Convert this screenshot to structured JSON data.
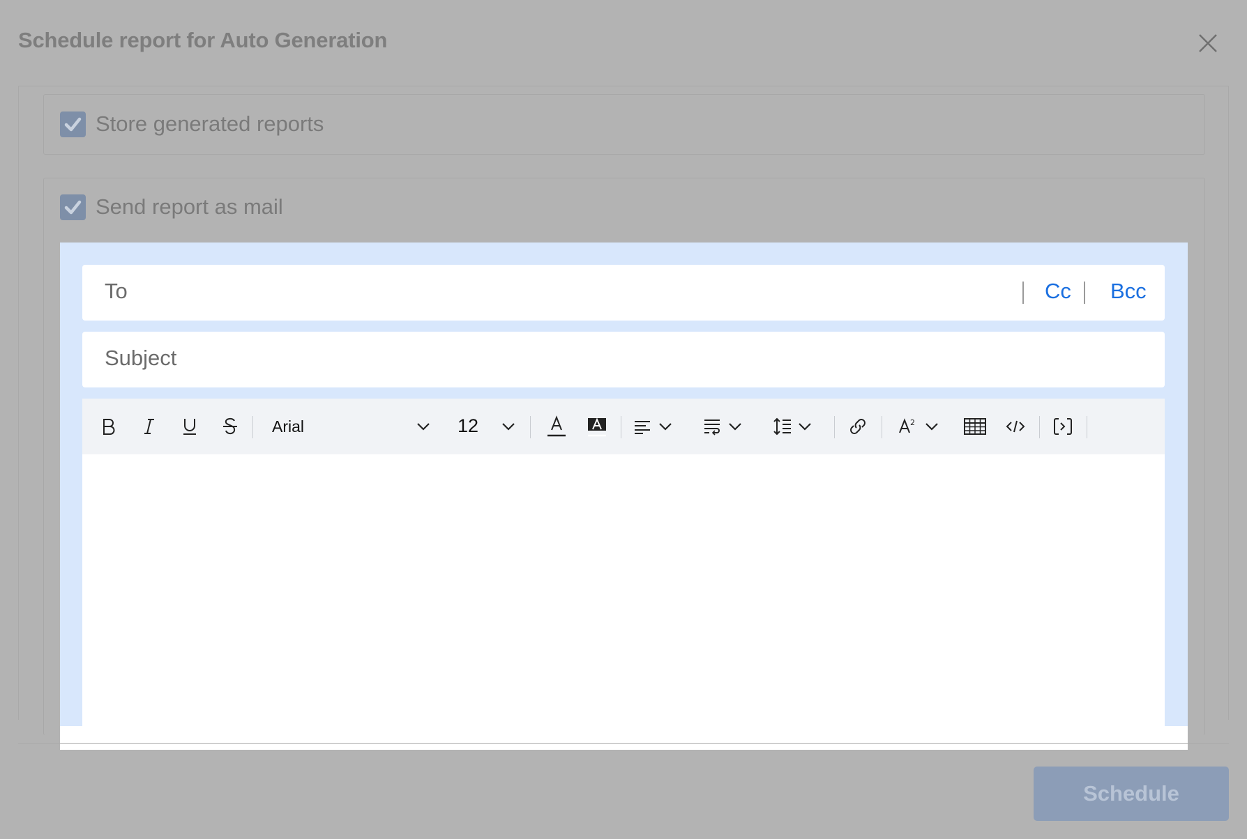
{
  "dialog": {
    "title": "Schedule report for Auto Generation"
  },
  "options": {
    "store": {
      "label": "Store generated reports",
      "checked": true
    },
    "mail": {
      "label": "Send report as mail",
      "checked": true
    }
  },
  "mail": {
    "to_label": "To",
    "cc_label": "Cc",
    "bcc_label": "Bcc",
    "subject_placeholder": "Subject",
    "body": ""
  },
  "toolbar": {
    "font": "Arial",
    "size": "12",
    "icons": [
      "bold-icon",
      "italic-icon",
      "underline-icon",
      "strikethrough-icon",
      "font-dropdown",
      "font-size-dropdown",
      "text-color-icon",
      "highlight-icon",
      "align-icon",
      "list-icon",
      "line-height-icon",
      "link-icon",
      "superscript-icon",
      "table-icon",
      "code-icon",
      "placeholder-icon"
    ]
  },
  "footer": {
    "schedule_label": "Schedule"
  },
  "colors": {
    "overlay": "#b3b3b3",
    "panel": "#d8e7fc",
    "link": "#1a6fe0",
    "button": "#8c9db7"
  }
}
